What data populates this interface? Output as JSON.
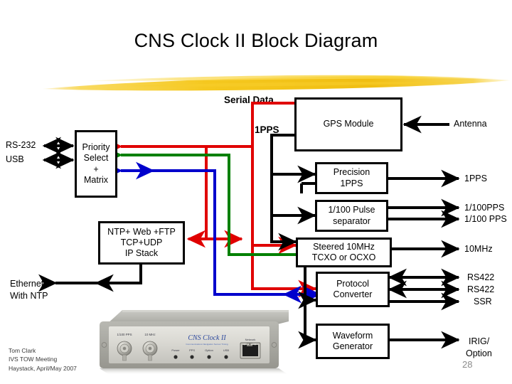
{
  "slide": {
    "title": "CNS Clock II Block Diagram",
    "page_number": "28",
    "credit_lines": [
      "Tom Clark",
      "IVS TOW Meeting",
      "Haystack, April/May 2007"
    ]
  },
  "colors": {
    "brush_yellow": "#F2C41D",
    "brush_yellow_light": "#FAD94F",
    "wire_black": "#000000",
    "wire_red": "#E00000",
    "wire_green": "#008000",
    "wire_blue": "#0000CC",
    "box_border": "#000000",
    "page_number": "#8C8C8C",
    "credit": "#3A3A3A"
  },
  "blocks": [
    {
      "id": "priority_select",
      "lines": [
        "Priority",
        "Select",
        "+",
        "Matrix"
      ]
    },
    {
      "id": "gps_module",
      "lines": [
        "GPS Module"
      ]
    },
    {
      "id": "precision_1pps",
      "lines": [
        "Precision",
        "1PPS"
      ]
    },
    {
      "id": "pulse_separator",
      "lines": [
        "1/100 Pulse",
        "separator"
      ]
    },
    {
      "id": "steered_10mhz",
      "lines": [
        "Steered 10MHz",
        "TCXO or OCXO"
      ]
    },
    {
      "id": "protocol_converter",
      "lines": [
        "Protocol",
        "Converter"
      ]
    },
    {
      "id": "waveform_generator",
      "lines": [
        "Waveform",
        "Generator"
      ]
    },
    {
      "id": "ip_stack",
      "lines": [
        "NTP+ Web +FTP",
        "TCP+UDP",
        "IP Stack"
      ]
    }
  ],
  "labels": {
    "serial_data": "Serial Data",
    "one_pps_internal": "1PPS",
    "rs232": "RS-232",
    "usb": "USB",
    "ethernet_line1": "Ethernet",
    "ethernet_line2": "With NTP",
    "antenna": "Antenna",
    "out_1pps": "1PPS",
    "out_100pps_a": "1/100PPS",
    "out_100pps_b": "1/100 PPS",
    "out_10mhz": "10MHz",
    "out_rs422_a": "RS422",
    "out_rs422_b": "RS422",
    "out_ssr": "SSR",
    "out_irig_line1": "IRIG/",
    "out_irig_line2": "Option"
  },
  "photo": {
    "caption": "CNS Clock II front panel photograph",
    "brand": "CNS Clock II",
    "tagline": "Communications Navigation Sensor Timing",
    "connector_labels": [
      "1/100 PPS",
      "10 MHz"
    ],
    "led_labels": [
      "Power",
      "PPS",
      "Option",
      "USB"
    ],
    "network_label": "Network"
  }
}
